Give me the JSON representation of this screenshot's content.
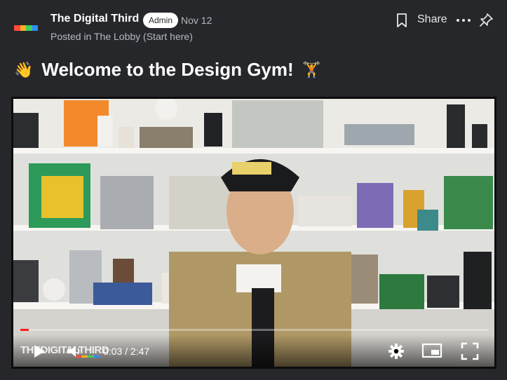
{
  "post": {
    "author": "The Digital Third",
    "badge": "Admin",
    "date": "Nov 12",
    "posted_in": "Posted in The Lobby (Start here)",
    "share_label": "Share",
    "title": "Welcome to the Design Gym!",
    "title_emoji_start": "👋",
    "title_emoji_end": "🏋",
    "avatar_colors": [
      "#ff4d3d",
      "#ffb020",
      "#3ecf5a",
      "#2f8cff"
    ]
  },
  "video": {
    "logo_text": "THEDIGITALTHIRD",
    "current_time": "0:03",
    "duration": "2:47",
    "time_display": "0:03 / 2:47",
    "progress_fraction": 0.018,
    "logo_colors": [
      "#ff4d3d",
      "#ffb020",
      "#3ecf5a",
      "#2f8cff"
    ],
    "icons": {
      "play": "play-icon",
      "volume": "volume-icon",
      "settings": "settings-icon",
      "pip": "picture-in-picture-icon",
      "fullscreen": "fullscreen-icon"
    }
  },
  "colors": {
    "background": "#26272b",
    "muted_text": "#b6b8bd",
    "progress_red": "#ff1f1f"
  }
}
